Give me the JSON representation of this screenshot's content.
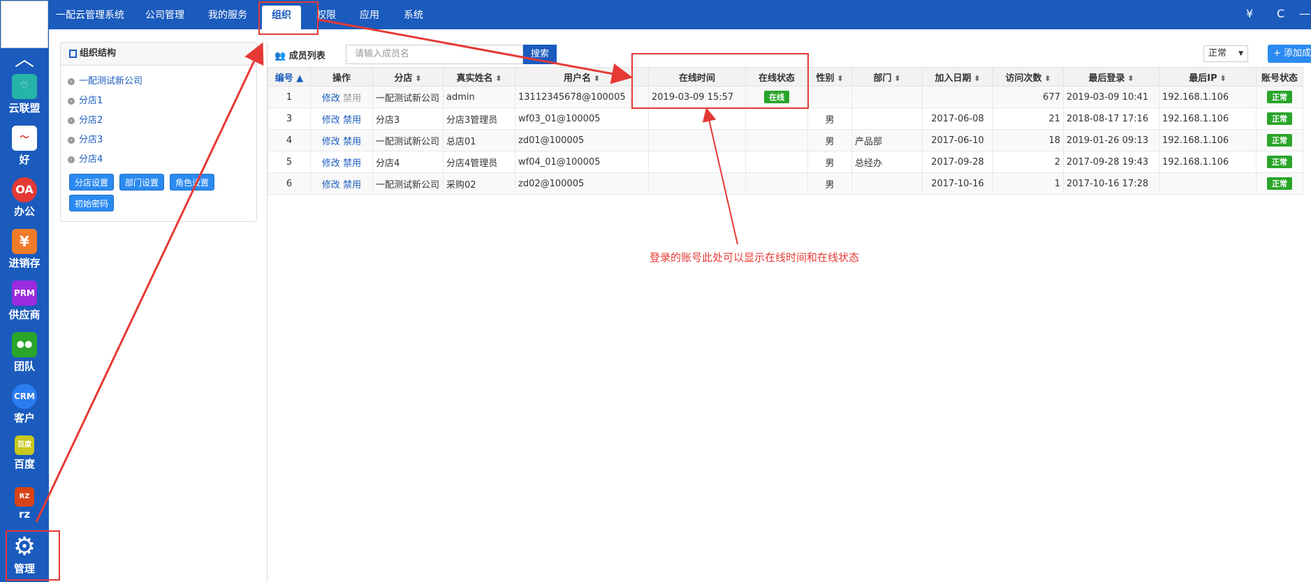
{
  "sidebar": {
    "apps": [
      {
        "label": "云联盟",
        "icon": "handshake-icon",
        "color": "#26b3a8",
        "glyph": "♡"
      },
      {
        "label": "好",
        "icon": "pulse-icon",
        "color": "#ffffff",
        "glyph": "〜"
      },
      {
        "label": "办公",
        "icon": "oa-icon",
        "color": "#e53935",
        "glyph": "OA"
      },
      {
        "label": "进销存",
        "icon": "yen-icon",
        "color": "#f07b2b",
        "glyph": "¥"
      },
      {
        "label": "供应商",
        "icon": "prm-icon",
        "color": "#9b2bdf",
        "glyph": "PRM"
      },
      {
        "label": "团队",
        "icon": "team-icon",
        "color": "#2aa52a",
        "glyph": "●●"
      },
      {
        "label": "客户",
        "icon": "crm-icon",
        "color": "#2b7cf0",
        "glyph": "CRM"
      },
      {
        "label": "百度",
        "icon": "baidu-icon",
        "color": "#c8c81e",
        "glyph": "百度"
      },
      {
        "label": "rz",
        "icon": "rz-icon",
        "color": "#d84315",
        "glyph": "RZ"
      },
      {
        "label": "管理",
        "icon": "gear-icon",
        "color": "#1a5bbd",
        "glyph": "⚙"
      }
    ]
  },
  "topnav": {
    "brand": "一配云管理系统",
    "items": [
      "公司管理",
      "我的服务",
      "组织",
      "权限",
      "应用",
      "系统"
    ],
    "active": "组织",
    "right_icons": [
      "¥",
      "C",
      "—"
    ]
  },
  "org": {
    "title": "组织结构",
    "nodes": [
      "一配测试新公司",
      "分店1",
      "分店2",
      "分店3",
      "分店4"
    ],
    "buttons": [
      "分店设置",
      "部门设置",
      "角色设置",
      "初始密码"
    ]
  },
  "members": {
    "title": "成员列表",
    "search_placeholder": "请输入成员名",
    "search_button": "搜索",
    "status_select": "正常",
    "add_button": "添加成员",
    "columns": [
      "编号",
      "操作",
      "分店",
      "真实姓名",
      "用户名",
      "在线时间",
      "在线状态",
      "性别",
      "部门",
      "加入日期",
      "访问次数",
      "最后登录",
      "最后IP",
      "账号状态"
    ],
    "rows": [
      {
        "id": "1",
        "edit": "修改",
        "disable": "禁用",
        "branch": "一配测试新公司",
        "name": "admin",
        "user": "13112345678@100005",
        "online_time": "2019-03-09 15:57",
        "online_status": "在线",
        "gender": "",
        "dept": "",
        "join": "",
        "visits": "677",
        "last_login": "2019-03-09 10:41",
        "ip": "192.168.1.106",
        "status": "正常"
      },
      {
        "id": "3",
        "edit": "修改",
        "disable": "禁用",
        "branch": "分店3",
        "name": "分店3管理员",
        "user": "wf03_01@100005",
        "online_time": "",
        "online_status": "",
        "gender": "男",
        "dept": "",
        "join": "2017-06-08",
        "visits": "21",
        "last_login": "2018-08-17 17:16",
        "ip": "192.168.1.106",
        "status": "正常"
      },
      {
        "id": "4",
        "edit": "修改",
        "disable": "禁用",
        "branch": "一配测试新公司",
        "name": "总店01",
        "user": "zd01@100005",
        "online_time": "",
        "online_status": "",
        "gender": "男",
        "dept": "产品部",
        "join": "2017-06-10",
        "visits": "18",
        "last_login": "2019-01-26 09:13",
        "ip": "192.168.1.106",
        "status": "正常"
      },
      {
        "id": "5",
        "edit": "修改",
        "disable": "禁用",
        "branch": "分店4",
        "name": "分店4管理员",
        "user": "wf04_01@100005",
        "online_time": "",
        "online_status": "",
        "gender": "男",
        "dept": "总经办",
        "join": "2017-09-28",
        "visits": "2",
        "last_login": "2017-09-28 19:43",
        "ip": "192.168.1.106",
        "status": "正常"
      },
      {
        "id": "6",
        "edit": "修改",
        "disable": "禁用",
        "branch": "一配测试新公司",
        "name": "采购02",
        "user": "zd02@100005",
        "online_time": "",
        "online_status": "",
        "gender": "男",
        "dept": "",
        "join": "2017-10-16",
        "visits": "1",
        "last_login": "2017-10-16 17:28",
        "ip": "",
        "status": "正常"
      }
    ]
  },
  "annotation": {
    "note": "登录的账号此处可以显示在线时间和在线状态",
    "color": "#e53935"
  }
}
